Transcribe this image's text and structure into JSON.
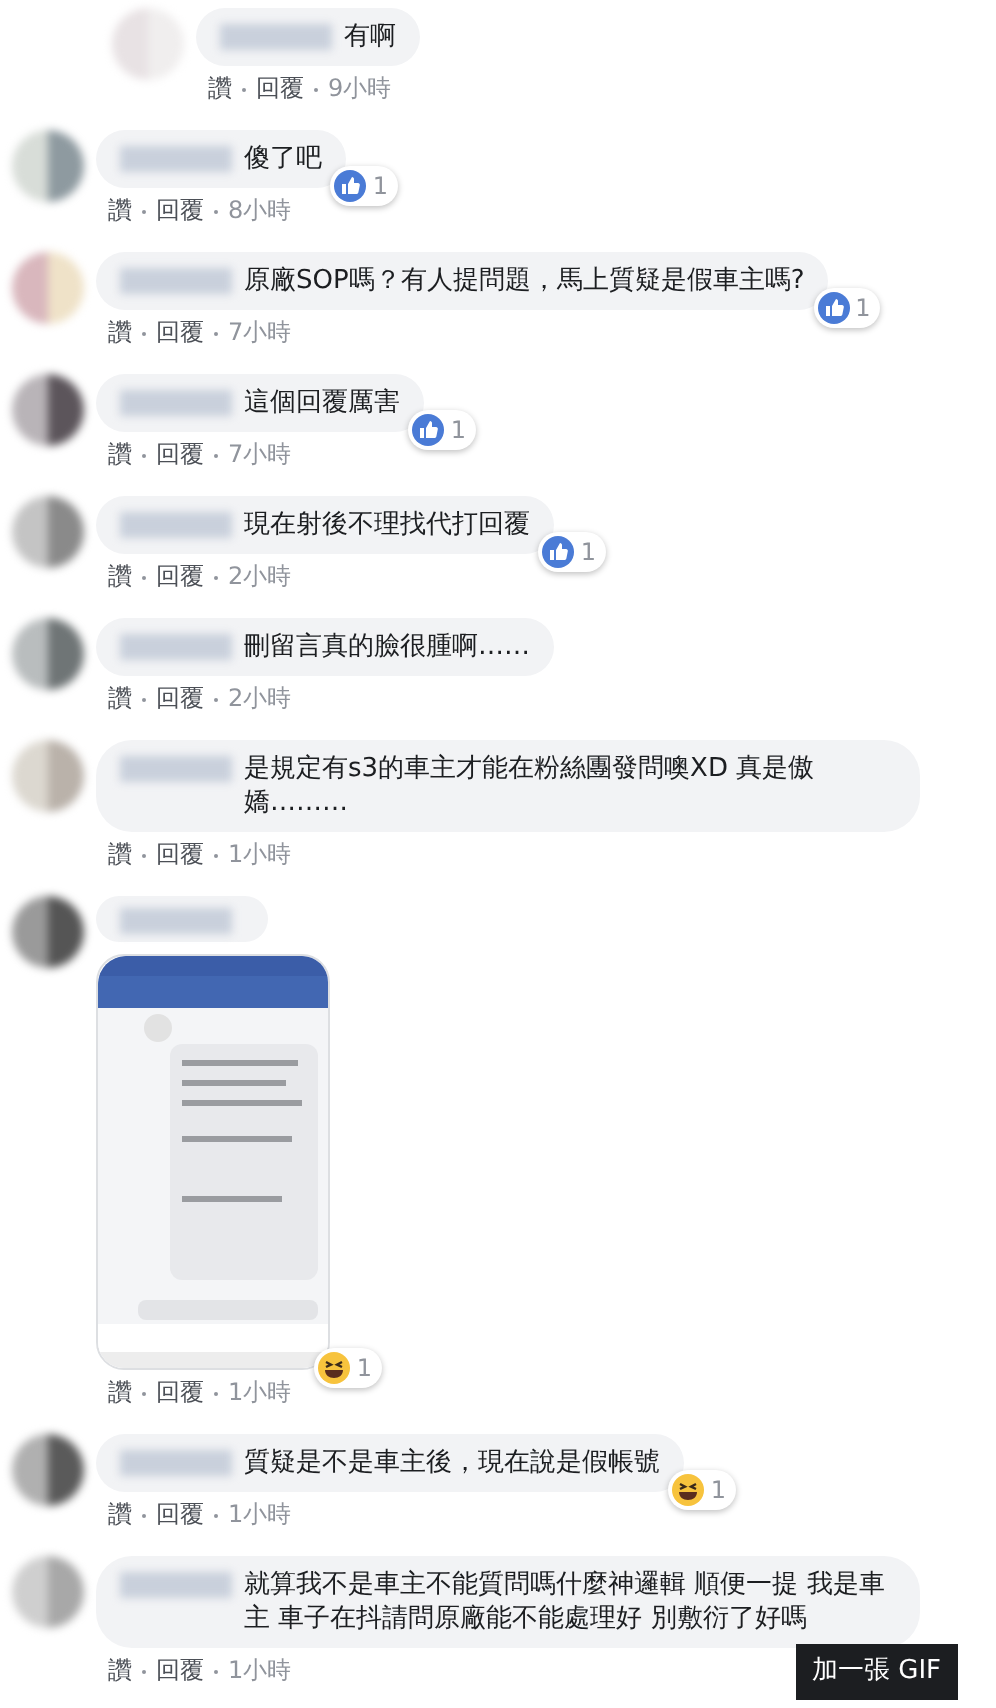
{
  "comments": [
    {
      "kind": "reply",
      "text": "有啊",
      "time": "9小時",
      "actions": [
        "讚",
        "回覆"
      ]
    },
    {
      "kind": "comment",
      "text": "傻了吧",
      "reaction": {
        "kind": "like",
        "count": "1"
      },
      "time": "8小時",
      "actions": [
        "讚",
        "回覆"
      ]
    },
    {
      "kind": "comment",
      "text": "原廠SOP嗎？有人提問題，馬上質疑是假車主嗎?",
      "reaction": {
        "kind": "like",
        "count": "1"
      },
      "time": "7小時",
      "actions": [
        "讚",
        "回覆"
      ]
    },
    {
      "kind": "comment",
      "text": "這個回覆厲害",
      "reaction": {
        "kind": "like",
        "count": "1"
      },
      "time": "7小時",
      "actions": [
        "讚",
        "回覆"
      ]
    },
    {
      "kind": "comment",
      "text": "現在射後不理找代打回覆",
      "reaction": {
        "kind": "like",
        "count": "1"
      },
      "time": "2小時",
      "actions": [
        "讚",
        "回覆"
      ]
    },
    {
      "kind": "comment",
      "text": "刪留言真的臉很腫啊……",
      "time": "2小時",
      "actions": [
        "讚",
        "回覆"
      ]
    },
    {
      "kind": "comment",
      "text": "是規定有s3的車主才能在粉絲團發問噢XD 真是傲嬌………",
      "time": "1小時",
      "actions": [
        "讚",
        "回覆"
      ]
    },
    {
      "reaction": {
        "kind": "haha",
        "count": "1"
      },
      "time": "1小時",
      "actions": [
        "讚",
        "回覆"
      ]
    },
    {
      "kind": "comment",
      "text": "質疑是不是車主後，現在說是假帳號",
      "reaction": {
        "kind": "haha",
        "count": "1"
      },
      "time": "1小時",
      "actions": [
        "讚",
        "回覆"
      ]
    },
    {
      "kind": "comment",
      "text": "就算我不是車主不能質問嗎什麼神邏輯 順便一提 我是車主 車子在抖請問原廠能不能處理好 別敷衍了好嗎",
      "time": "1小時",
      "actions": [
        "讚",
        "回覆"
      ]
    }
  ],
  "tooltip": {
    "text": "加一張 GIF"
  }
}
